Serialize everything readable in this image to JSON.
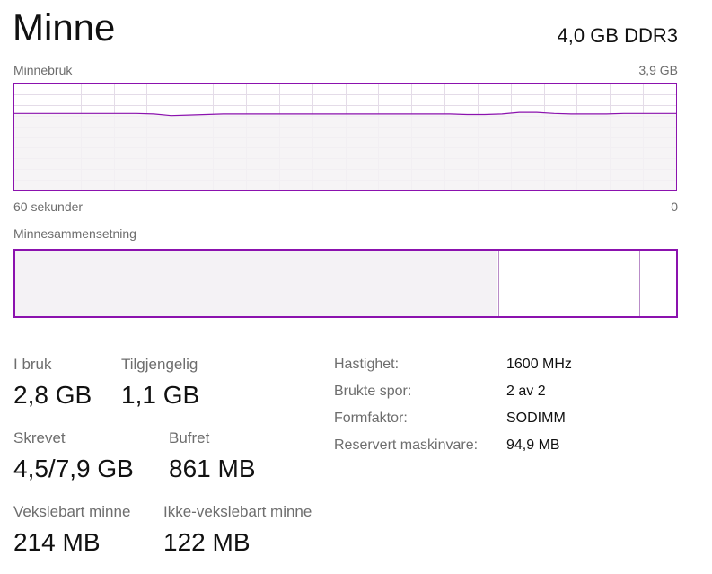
{
  "header": {
    "title": "Minne",
    "spec": "4,0 GB DDR3"
  },
  "usage_graph": {
    "label": "Minnebruk",
    "max_label": "3,9 GB",
    "time_label": "60 sekunder",
    "min_label": "0",
    "series": [
      0.72,
      0.72,
      0.72,
      0.72,
      0.72,
      0.72,
      0.72,
      0.72,
      0.715,
      0.7,
      0.705,
      0.71,
      0.715,
      0.715,
      0.715,
      0.715,
      0.715,
      0.715,
      0.715,
      0.715,
      0.715,
      0.715,
      0.715,
      0.715,
      0.715,
      0.715,
      0.71,
      0.71,
      0.715,
      0.73,
      0.73,
      0.72,
      0.715,
      0.715,
      0.715,
      0.72,
      0.72,
      0.72,
      0.72
    ]
  },
  "composition": {
    "label": "Minnesammensetning",
    "segments": [
      {
        "name": "in-use",
        "fraction": 0.728
      },
      {
        "name": "modified",
        "fraction": 0.004
      },
      {
        "name": "standby",
        "fraction": 0.213
      },
      {
        "name": "free",
        "fraction": 0.055
      }
    ]
  },
  "stats": {
    "in_use": {
      "label": "I bruk",
      "value": "2,8 GB"
    },
    "available": {
      "label": "Tilgjengelig",
      "value": "1,1 GB"
    },
    "committed": {
      "label": "Skrevet",
      "value": "4,5/7,9 GB"
    },
    "cached": {
      "label": "Bufret",
      "value": "861 MB"
    },
    "paged_pool": {
      "label": "Vekslebart minne",
      "value": "214 MB"
    },
    "nonpaged_pool": {
      "label": "Ikke-vekslebart minne",
      "value": "122 MB"
    }
  },
  "details": {
    "speed": {
      "label": "Hastighet:",
      "value": "1600 MHz"
    },
    "slots": {
      "label": "Brukte spor:",
      "value": "2 av 2"
    },
    "form_factor": {
      "label": "Formfaktor:",
      "value": "SODIMM"
    },
    "reserved": {
      "label": "Reservert maskinvare:",
      "value": "94,9 MB"
    }
  },
  "colors": {
    "accent": "#8b12ae",
    "fill": "#f4f2f5",
    "grid": "#e4dce8"
  }
}
